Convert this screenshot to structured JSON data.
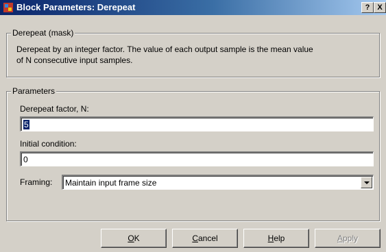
{
  "window": {
    "title": "Block Parameters: Derepeat",
    "help_glyph": "?",
    "close_glyph": "X"
  },
  "mask_group": {
    "legend": "Derepeat (mask)",
    "description_line1": "Derepeat by an integer factor.  The value of each output sample is the mean value",
    "description_line2": "of N consecutive input samples."
  },
  "params_group": {
    "legend": "Parameters",
    "derepeat_factor": {
      "label": "Derepeat factor, N:",
      "value": "5"
    },
    "initial_condition": {
      "label": "Initial condition:",
      "value": "0"
    },
    "framing": {
      "label": "Framing:",
      "selected": "Maintain input frame size"
    }
  },
  "buttons": {
    "ok": {
      "accel": "O",
      "rest": "K"
    },
    "cancel": {
      "accel": "C",
      "rest": "ancel"
    },
    "help": {
      "accel": "H",
      "rest": "elp"
    },
    "apply": {
      "accel": "A",
      "rest": "pply"
    }
  }
}
